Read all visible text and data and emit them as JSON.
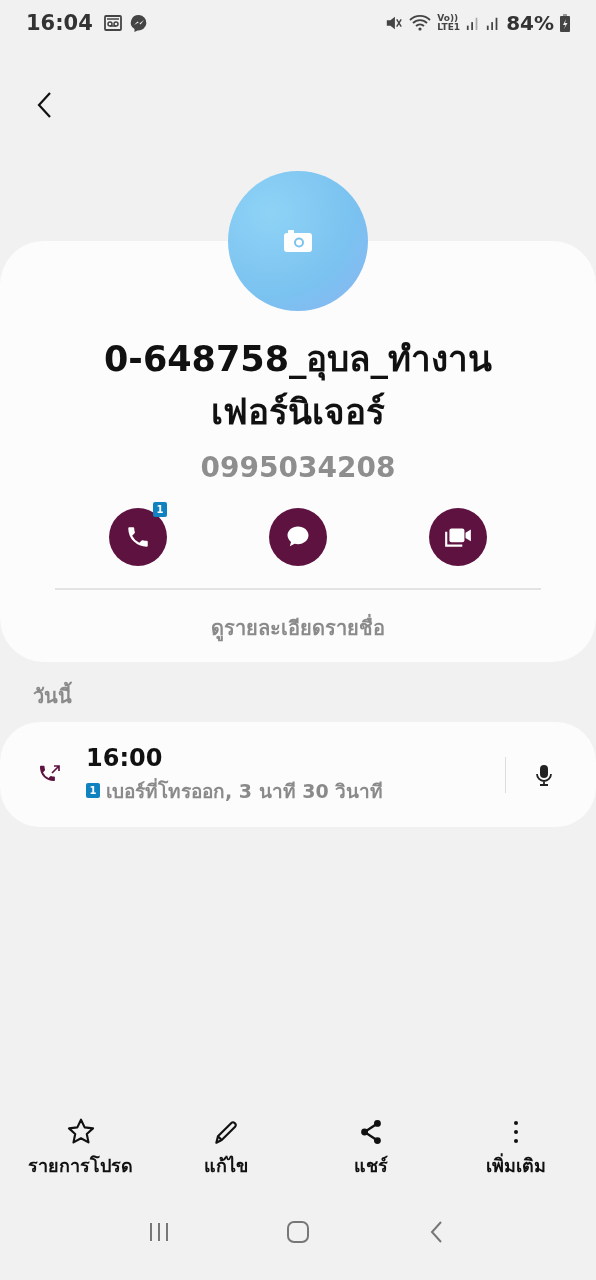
{
  "status_bar": {
    "time": "16:04",
    "network_top": "Vo))",
    "network_bottom": "LTE1",
    "battery": "84%"
  },
  "contact": {
    "name": "0-648758_อุบล_ทำงานเฟอร์นิเจอร์",
    "number": "0995034208",
    "details_link": "ดูรายละเอียดรายชื่อ",
    "actions": [
      {
        "kind": "call",
        "badge": "1"
      },
      {
        "kind": "message"
      },
      {
        "kind": "video"
      }
    ]
  },
  "history": {
    "heading": "วันนี้",
    "entries": [
      {
        "time": "16:00",
        "sim": "1",
        "description": "เบอร์ที่โทรออก, 3 นาที 30 วินาที",
        "kind": "outgoing"
      }
    ]
  },
  "toolbar": [
    {
      "kind": "favorite",
      "label": "รายการโปรด"
    },
    {
      "kind": "edit",
      "label": "แก้ไข"
    },
    {
      "kind": "share",
      "label": "แชร์"
    },
    {
      "kind": "more",
      "label": "เพิ่มเติม"
    }
  ]
}
